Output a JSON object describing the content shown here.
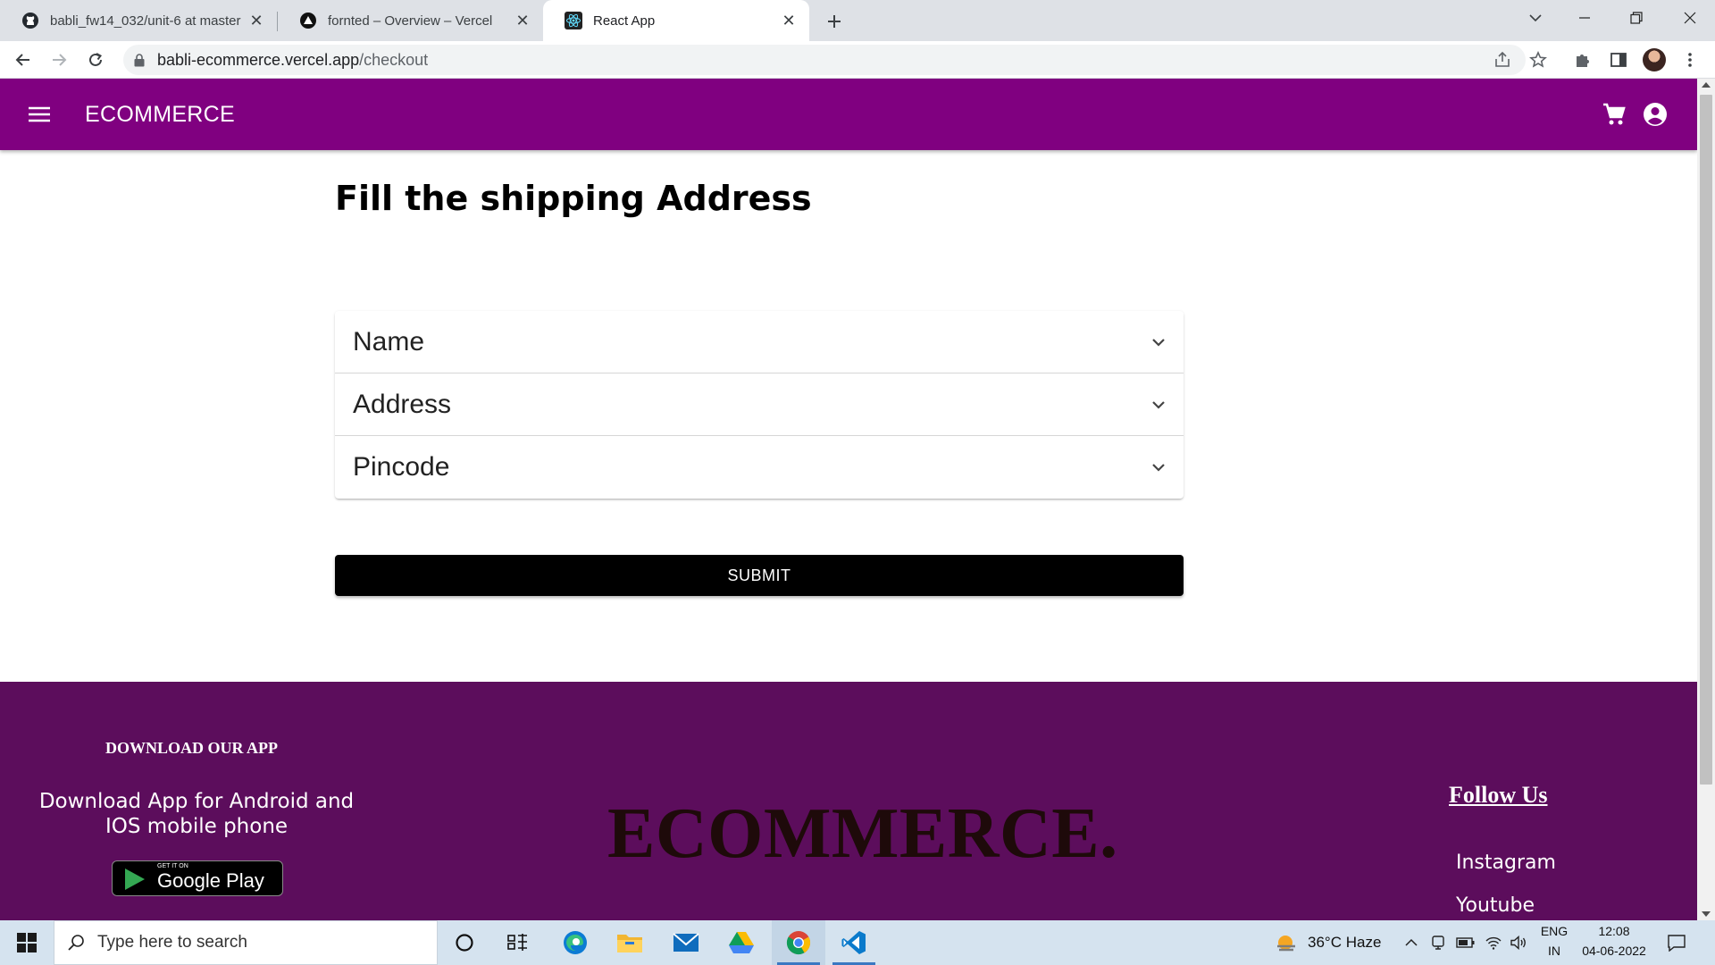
{
  "browser": {
    "tabs": [
      {
        "title": "babli_fw14_032/unit-6 at master",
        "favicon": "github-icon",
        "active": false
      },
      {
        "title": "fornted – Overview – Vercel",
        "favicon": "vercel-icon",
        "active": false
      },
      {
        "title": "React App",
        "favicon": "react-icon",
        "active": true
      }
    ],
    "url_host": "babli-ecommerce.vercel.app",
    "url_path": "/checkout"
  },
  "app": {
    "brand": "ECOMMERCE",
    "colors": {
      "appbar": "#800080",
      "footer": "#5c0d5c",
      "submit": "#000000"
    }
  },
  "checkout": {
    "heading": "Fill the shipping Address",
    "fields": [
      {
        "label": "Name"
      },
      {
        "label": "Address"
      },
      {
        "label": "Pincode"
      }
    ],
    "submit_label": "SUBMIT"
  },
  "footer": {
    "download_title": "DOWNLOAD OUR APP",
    "download_desc": "Download App for Android and IOS mobile phone",
    "play_store_small": "GET IT ON",
    "play_store_big": "Google Play",
    "brand": "ECOMMERCE.",
    "follow_title": "Follow Us",
    "social": [
      "Instagram",
      "Youtube"
    ]
  },
  "taskbar": {
    "search_placeholder": "Type here to search",
    "weather": "36°C  Haze",
    "lang_top": "ENG",
    "lang_bottom": "IN",
    "time": "12:08",
    "date": "04-06-2022"
  }
}
